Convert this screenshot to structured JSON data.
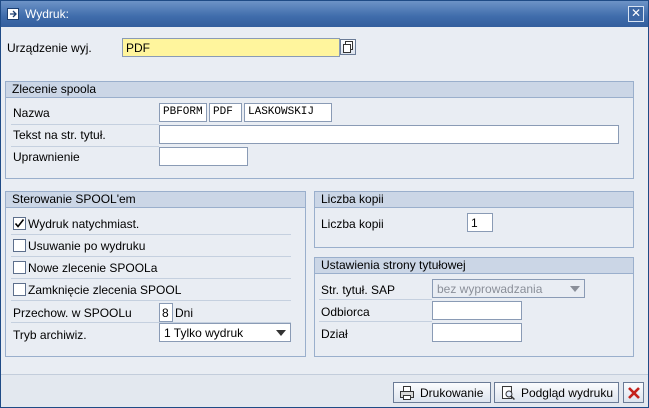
{
  "window": {
    "title": "Wydruk:"
  },
  "device": {
    "label": "Urządzenie wyj.",
    "value": "PDF"
  },
  "spool_request": {
    "heading": "Zlecenie spoola",
    "name_label": "Nazwa",
    "name_parts": [
      "PBFORM",
      "PDF",
      "LASKOWSKIJ"
    ],
    "title_text_label": "Tekst na str. tytuł.",
    "title_text_value": "",
    "authorization_label": "Uprawnienie",
    "authorization_value": ""
  },
  "spool_control": {
    "heading": "Sterowanie SPOOL'em",
    "print_immediately": {
      "label": "Wydruk natychmiast.",
      "checked": true
    },
    "delete_after_print": {
      "label": "Usuwanie po wydruku",
      "checked": false
    },
    "new_spool_request": {
      "label": "Nowe zlecenie SPOOLa",
      "checked": false
    },
    "close_spool_request": {
      "label": "Zamknięcie zlecenia SPOOL",
      "checked": false
    },
    "retention_label": "Przechow. w SPOOLu",
    "retention_value": "8",
    "retention_unit": "Dni",
    "archive_mode_label": "Tryb archiwiz.",
    "archive_mode_value": "1 Tylko wydruk"
  },
  "copies": {
    "heading": "Liczba kopii",
    "label": "Liczba kopii",
    "value": "1"
  },
  "cover_page": {
    "heading": "Ustawienia strony tytułowej",
    "sap_cover_label": "Str. tytuł. SAP",
    "sap_cover_value": "bez wyprowadzania",
    "recipient_label": "Odbiorca",
    "recipient_value": "",
    "department_label": "Dział",
    "department_value": ""
  },
  "buttons": {
    "print": "Drukowanie",
    "preview": "Podgląd wydruku"
  }
}
